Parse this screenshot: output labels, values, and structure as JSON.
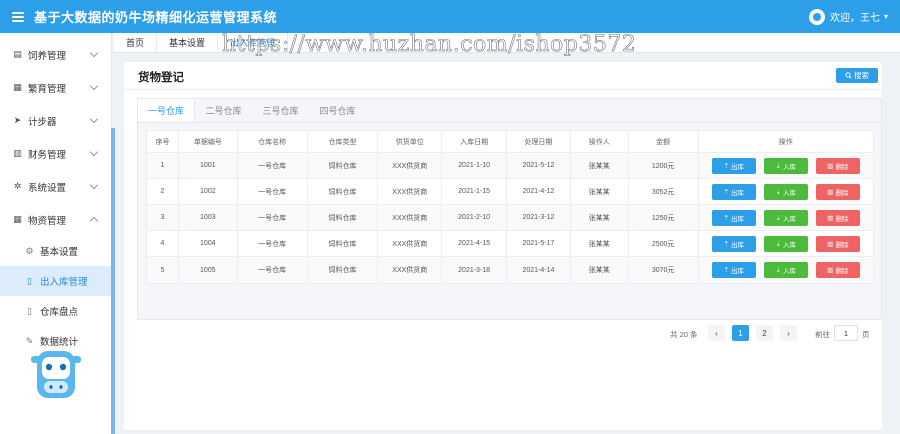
{
  "header": {
    "app_title": "基于大数据的奶牛场精细化运营管理系统",
    "user_greeting": "欢迎，王七",
    "caret": "▾"
  },
  "sidebar": {
    "items": [
      {
        "label": "饲养管理",
        "icon": "layers-icon"
      },
      {
        "label": "繁育管理",
        "icon": "grid-icon"
      },
      {
        "label": "计步器",
        "icon": "send-icon"
      },
      {
        "label": "财务管理",
        "icon": "chart-icon"
      },
      {
        "label": "系统设置",
        "icon": "gear-icon"
      },
      {
        "label": "物资管理",
        "icon": "apps-icon"
      }
    ],
    "sub_items": [
      {
        "label": "基本设置",
        "icon": "gear-icon"
      },
      {
        "label": "出入库管理",
        "icon": "document-icon"
      },
      {
        "label": "仓库盘点",
        "icon": "document-icon"
      },
      {
        "label": "数据统计",
        "icon": "edit-icon"
      }
    ]
  },
  "breadcrumbs": [
    "首页",
    "基本设置",
    "出入库管理"
  ],
  "card": {
    "title": "货物登记",
    "search_label": "搜索"
  },
  "tabs": [
    "一号仓库",
    "二号仓库",
    "三号仓库",
    "四号仓库"
  ],
  "table": {
    "headers": [
      "序号",
      "单据编号",
      "仓库名称",
      "仓库类型",
      "供货单位",
      "入库日期",
      "处理日期",
      "操作人",
      "金额",
      "操作"
    ],
    "rows": [
      [
        "1",
        "1001",
        "一号仓库",
        "饲料仓库",
        "XXX供货商",
        "2021-1-10",
        "2021-5-12",
        "张某某",
        "1200元"
      ],
      [
        "2",
        "1002",
        "一号仓库",
        "饲料仓库",
        "XXX供货商",
        "2021-1-15",
        "2021-4-12",
        "张某某",
        "3052元"
      ],
      [
        "3",
        "1003",
        "一号仓库",
        "饲料仓库",
        "XXX供货商",
        "2021-2-10",
        "2021-3-12",
        "张某某",
        "1250元"
      ],
      [
        "4",
        "1004",
        "一号仓库",
        "饲料仓库",
        "XXX供货商",
        "2021-4-15",
        "2021-5-17",
        "张某某",
        "2500元"
      ],
      [
        "5",
        "1005",
        "一号仓库",
        "饲料仓库",
        "XXX供货商",
        "2021-3-18",
        "2021-4-14",
        "张某某",
        "3070元"
      ]
    ],
    "actions": {
      "out": "出库",
      "in": "入库",
      "delete": "删除"
    }
  },
  "pagination": {
    "total": "共 20 条",
    "prev": "‹",
    "next": "›",
    "pages": [
      "1",
      "2"
    ],
    "goto_label": "前往",
    "page_value": "1",
    "page_unit": "页"
  },
  "watermark": "https://www.huzhan.com/ishop3572",
  "colors": {
    "primary": "#2d9ee8",
    "success": "#4cba3a",
    "danger": "#ee6464"
  }
}
